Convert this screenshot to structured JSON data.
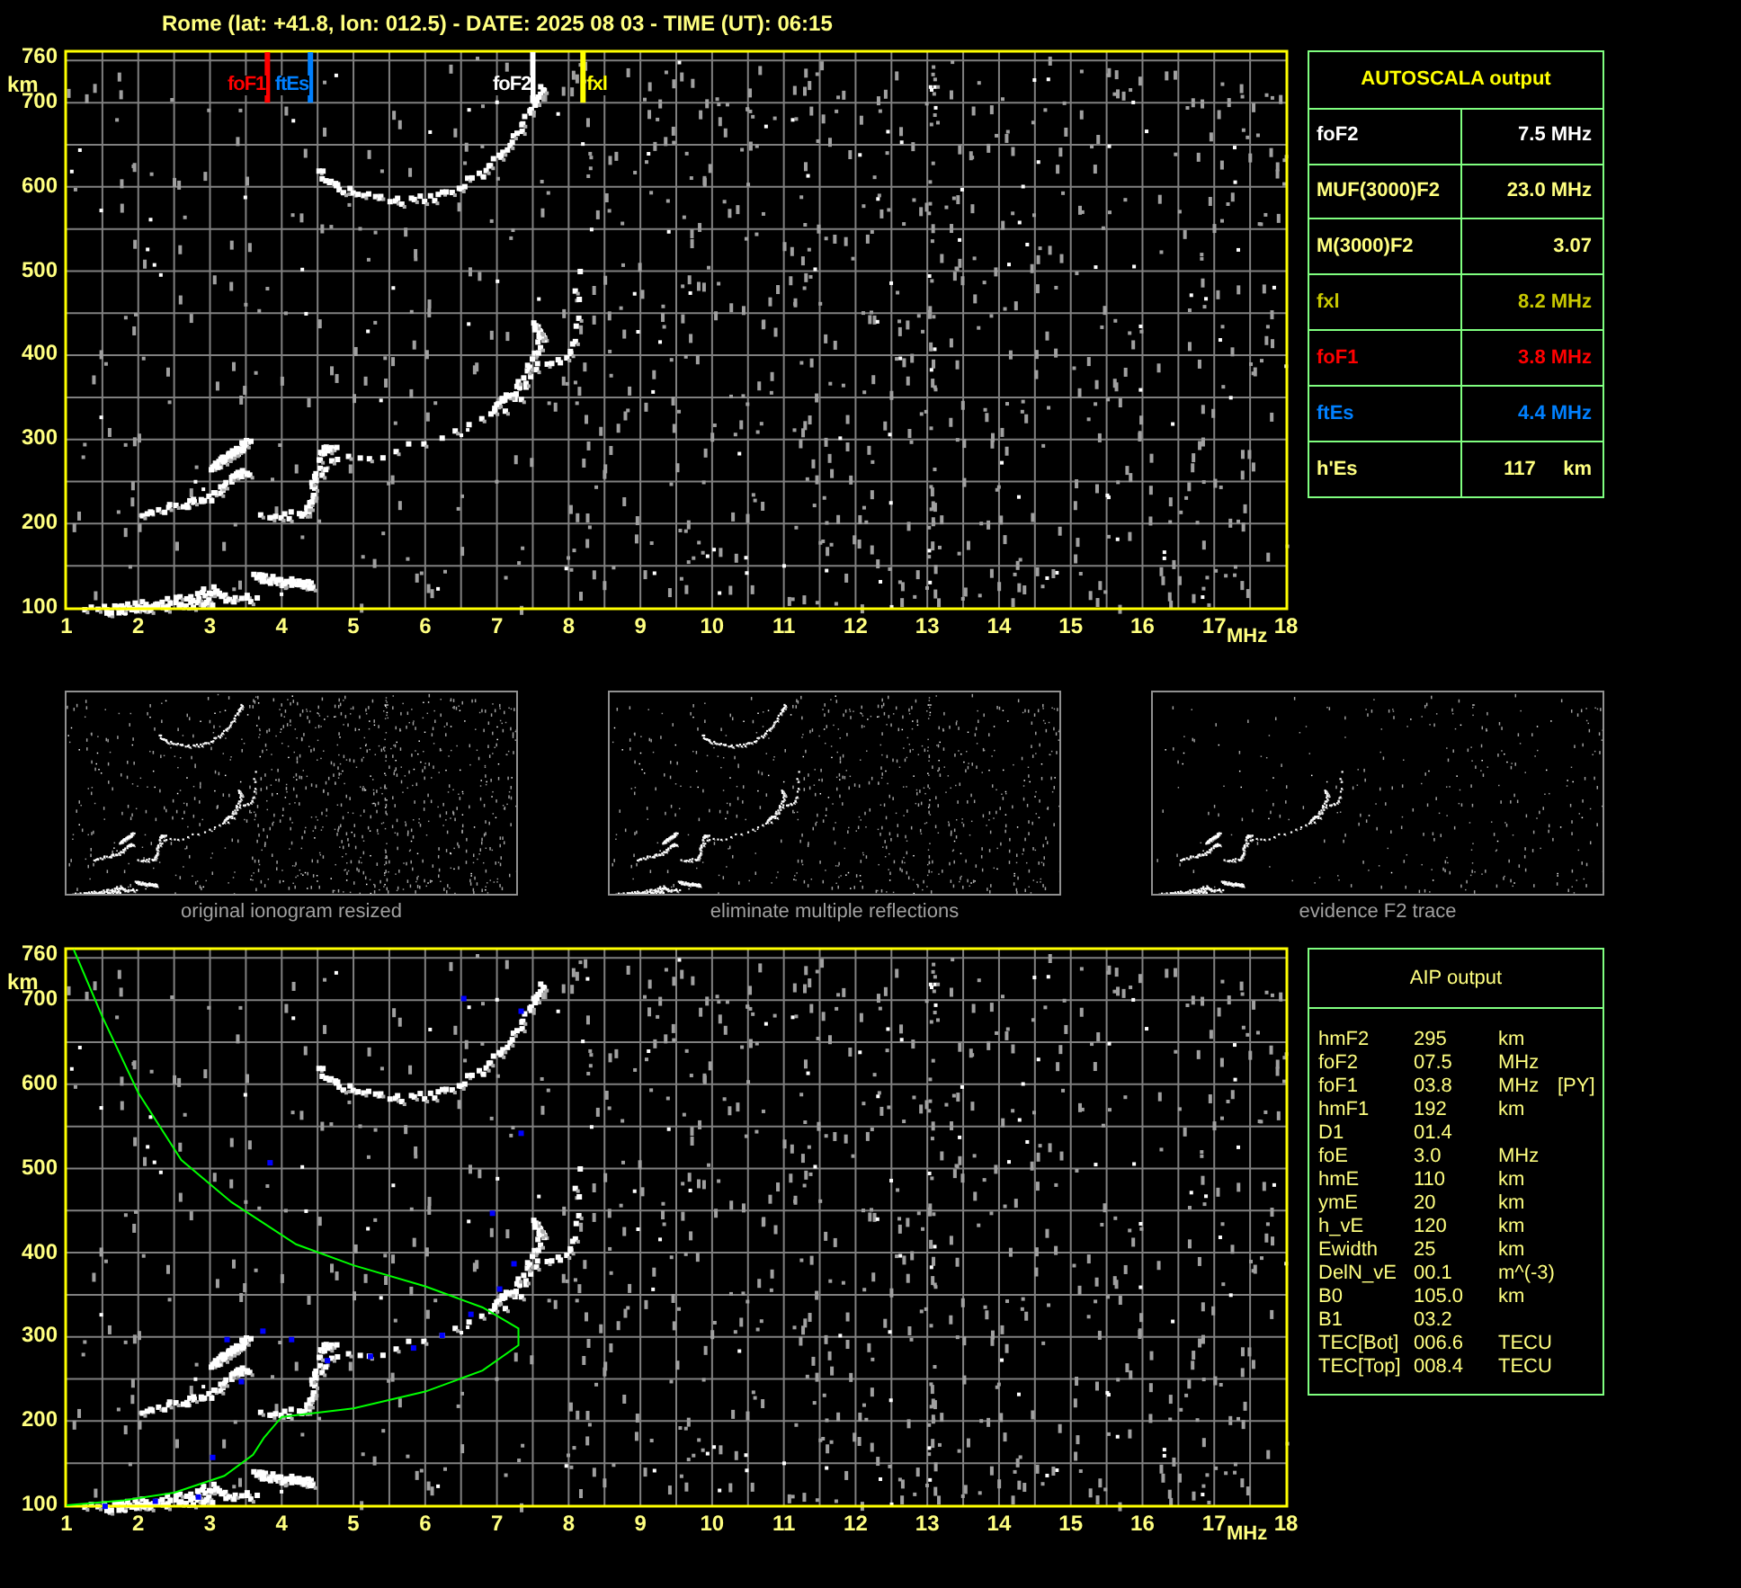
{
  "title": "Rome (lat: +41.8, lon: 012.5) - DATE: 2025 08 03 - TIME (UT): 06:15",
  "ionogram": {
    "y_ticks": [
      "760",
      "700",
      "600",
      "500",
      "400",
      "300",
      "200",
      "100"
    ],
    "y_unit": "km",
    "x_ticks": [
      "1",
      "2",
      "3",
      "4",
      "5",
      "6",
      "7",
      "8",
      "9",
      "10",
      "11",
      "12",
      "13",
      "14",
      "15",
      "16",
      "17",
      "18"
    ],
    "x_unit": "MHz",
    "markers": [
      {
        "label": "foF1",
        "color": "#ff0000"
      },
      {
        "label": "ftEs",
        "color": "#0080ff"
      },
      {
        "label": "foF2",
        "color": "#ffffff"
      },
      {
        "label": "fxl",
        "color": "#ffff00"
      }
    ]
  },
  "autoscala": {
    "title": "AUTOSCALA output",
    "rows": [
      {
        "label": "foF2",
        "value": "7.5 MHz",
        "color": "#ffffff"
      },
      {
        "label": "MUF(3000)F2",
        "value": "23.0 MHz",
        "color": "#ffff80"
      },
      {
        "label": "M(3000)F2",
        "value": "3.07",
        "color": "#ffff80"
      },
      {
        "label": "fxl",
        "value": "8.2 MHz",
        "color": "#c8c800"
      },
      {
        "label": "foF1",
        "value": "3.8 MHz",
        "color": "#ff0000"
      },
      {
        "label": "ftEs",
        "value": "4.4 MHz",
        "color": "#0080ff"
      },
      {
        "label": "h'Es",
        "value": "117     km",
        "color": "#ffff80"
      }
    ]
  },
  "thumbnails": [
    {
      "caption": "original ionogram resized",
      "kind": "original"
    },
    {
      "caption": "eliminate multiple reflections",
      "kind": "no_multiples"
    },
    {
      "caption": "evidence F2 trace",
      "kind": "f2_only"
    }
  ],
  "aip_ionogram": {
    "y_ticks": [
      "760",
      "700",
      "600",
      "500",
      "400",
      "300",
      "200",
      "100"
    ],
    "y_unit": "km",
    "x_ticks": [
      "1",
      "2",
      "3",
      "4",
      "5",
      "6",
      "7",
      "8",
      "9",
      "10",
      "11",
      "12",
      "13",
      "14",
      "15",
      "16",
      "17",
      "18"
    ],
    "x_unit": "MHz"
  },
  "aip": {
    "title": "AIP output",
    "rows": [
      {
        "name": "hmF2",
        "value": "295",
        "unit": "km"
      },
      {
        "name": "foF2",
        "value": "07.5",
        "unit": "MHz"
      },
      {
        "name": "foF1",
        "value": "03.8",
        "unit": "MHz",
        "note": "[PY]"
      },
      {
        "name": "hmF1",
        "value": "192",
        "unit": "km"
      },
      {
        "name": "D1",
        "value": "01.4"
      },
      {
        "name": "foE",
        "value": "3.0",
        "unit": "MHz"
      },
      {
        "name": "hmE",
        "value": "110",
        "unit": "km"
      },
      {
        "name": "ymE",
        "value": "20",
        "unit": "km"
      },
      {
        "name": "h_vE",
        "value": "120",
        "unit": "km"
      },
      {
        "name": "Ewidth",
        "value": "25",
        "unit": "km"
      },
      {
        "name": "DelN_vE",
        "value": "00.1",
        "unit": "m^(-3)"
      },
      {
        "name": "B0",
        "value": "105.0",
        "unit": "km"
      },
      {
        "name": "B1",
        "value": "03.2"
      },
      {
        "name": "TEC[Bot]",
        "value": "006.6",
        "unit": "TECU"
      },
      {
        "name": "TEC[Top]",
        "value": "008.4",
        "unit": "TECU"
      }
    ]
  }
}
